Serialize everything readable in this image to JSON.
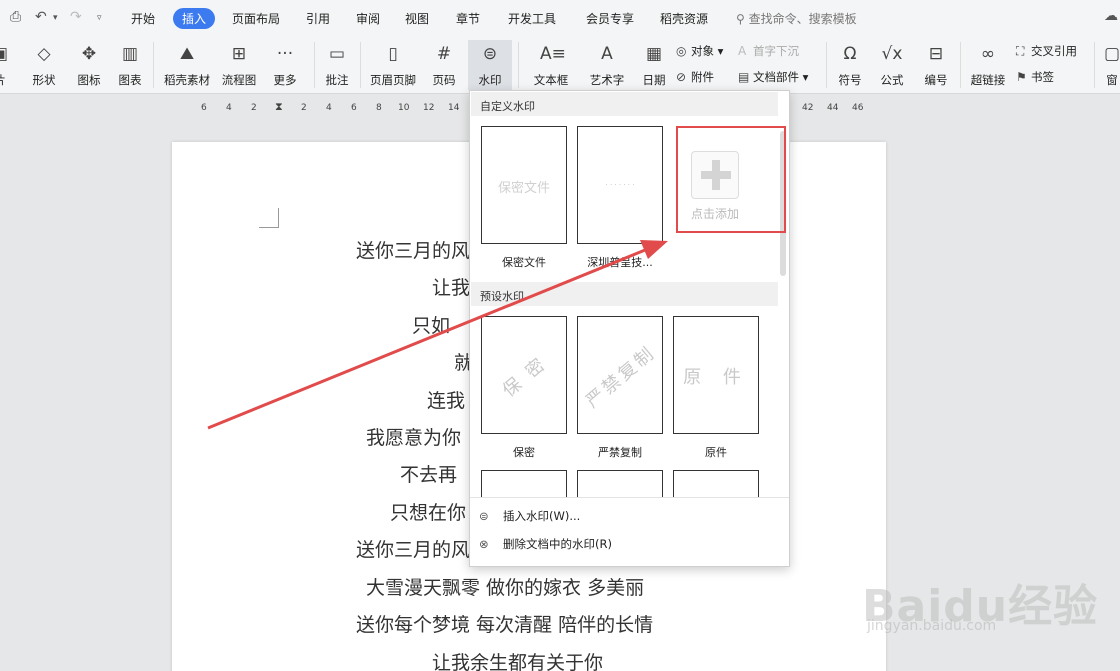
{
  "menubar": {
    "tabs": [
      "开始",
      "插入",
      "页面布局",
      "引用",
      "审阅",
      "视图",
      "章节",
      "开发工具",
      "会员专享",
      "稻壳资源"
    ],
    "active_tab": "插入",
    "search": "查找命令、搜索模板"
  },
  "ribbon": {
    "items": [
      {
        "label": "片",
        "icon": "picture-icon"
      },
      {
        "label": "形状",
        "icon": "shapes-icon"
      },
      {
        "label": "图标",
        "icon": "icons-icon"
      },
      {
        "label": "图表",
        "icon": "chart-icon"
      },
      {
        "label": "稻壳素材",
        "icon": "material-icon"
      },
      {
        "label": "流程图",
        "icon": "flowchart-icon"
      },
      {
        "label": "更多",
        "icon": "more-icon"
      },
      {
        "label": "批注",
        "icon": "comment-icon"
      },
      {
        "label": "页眉页脚",
        "icon": "header-footer-icon"
      },
      {
        "label": "页码",
        "icon": "page-number-icon"
      },
      {
        "label": "水印",
        "icon": "watermark-icon"
      },
      {
        "label": "文本框",
        "icon": "textbox-icon"
      },
      {
        "label": "艺术字",
        "icon": "wordart-icon"
      },
      {
        "label": "日期",
        "icon": "date-icon"
      },
      {
        "label": "符号",
        "icon": "symbol-icon"
      },
      {
        "label": "公式",
        "icon": "formula-icon"
      },
      {
        "label": "编号",
        "icon": "numbering-icon"
      },
      {
        "label": "超链接",
        "icon": "hyperlink-icon"
      },
      {
        "label": "窗",
        "icon": "window-icon"
      }
    ],
    "small": {
      "object": "对象",
      "dropcap": "首字下沉",
      "attachment": "附件",
      "docpart": "文档部件",
      "crossref": "交叉引用",
      "bookmark": "书签"
    }
  },
  "ruler": {
    "ticks": [
      "6",
      "4",
      "2",
      "2",
      "4",
      "6",
      "8",
      "10",
      "12",
      "14",
      "42",
      "44",
      "46"
    ]
  },
  "document": {
    "lines": [
      "送你三月的风",
      "让我",
      "只如",
      "就",
      "连我",
      "我愿意为你",
      "不去再",
      "只想在你",
      "送你三月的风",
      "大雪漫天飘零  做你的嫁衣  多美丽",
      "送你每个梦境  每次清醒  陪伴的长情",
      "让我余生都有关于你"
    ]
  },
  "dropdown": {
    "custom_title": "自定义水印",
    "custom": [
      {
        "label": "保密文件",
        "mark": "保密文件"
      },
      {
        "label": "深圳普呈技...",
        "mark": "· · · · · · ·"
      }
    ],
    "add_label": "点击添加",
    "preset_title": "预设水印",
    "preset": [
      {
        "label": "保密",
        "mark": "保 密"
      },
      {
        "label": "严禁复制",
        "mark": "严禁复制"
      },
      {
        "label": "原件",
        "mark": "原 件"
      }
    ],
    "menu": [
      "插入水印(W)...",
      "删除文档中的水印(R)"
    ]
  },
  "watermark_logo": {
    "brand": "Baidu经验",
    "url": "jingyan.baidu.com"
  },
  "colors": {
    "accent": "#3c7af0",
    "highlight_red": "#e14b4b"
  }
}
